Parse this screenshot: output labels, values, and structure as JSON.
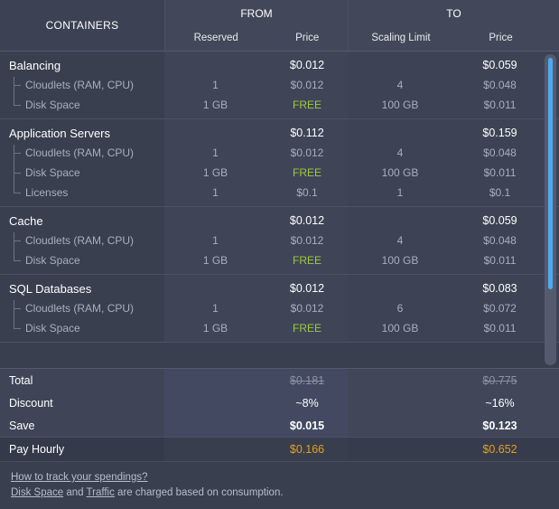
{
  "header": {
    "containers_label": "CONTAINERS",
    "from_label": "FROM",
    "to_label": "TO",
    "from_sub_reserved": "Reserved",
    "from_sub_price": "Price",
    "to_sub_scaling": "Scaling Limit",
    "to_sub_price": "Price"
  },
  "groups": [
    {
      "name": "Balancing",
      "from_price": "$0.012",
      "to_price": "$0.059",
      "items": [
        {
          "name": "Cloudlets (RAM, CPU)",
          "from_qty": "1",
          "from_price": "$0.012",
          "to_qty": "4",
          "to_price": "$0.048",
          "from_free": false
        },
        {
          "name": "Disk Space",
          "from_qty": "1 GB",
          "from_price": "FREE",
          "to_qty": "100 GB",
          "to_price": "$0.011",
          "from_free": true
        }
      ]
    },
    {
      "name": "Application Servers",
      "from_price": "$0.112",
      "to_price": "$0.159",
      "items": [
        {
          "name": "Cloudlets (RAM, CPU)",
          "from_qty": "1",
          "from_price": "$0.012",
          "to_qty": "4",
          "to_price": "$0.048",
          "from_free": false
        },
        {
          "name": "Disk Space",
          "from_qty": "1 GB",
          "from_price": "FREE",
          "to_qty": "100 GB",
          "to_price": "$0.011",
          "from_free": true
        },
        {
          "name": "Licenses",
          "from_qty": "1",
          "from_price": "$0.1",
          "to_qty": "1",
          "to_price": "$0.1",
          "from_free": false
        }
      ]
    },
    {
      "name": "Cache",
      "from_price": "$0.012",
      "to_price": "$0.059",
      "items": [
        {
          "name": "Cloudlets (RAM, CPU)",
          "from_qty": "1",
          "from_price": "$0.012",
          "to_qty": "4",
          "to_price": "$0.048",
          "from_free": false
        },
        {
          "name": "Disk Space",
          "from_qty": "1 GB",
          "from_price": "FREE",
          "to_qty": "100 GB",
          "to_price": "$0.011",
          "from_free": true
        }
      ]
    },
    {
      "name": "SQL Databases",
      "from_price": "$0.012",
      "to_price": "$0.083",
      "items": [
        {
          "name": "Cloudlets (RAM, CPU)",
          "from_qty": "1",
          "from_price": "$0.012",
          "to_qty": "6",
          "to_price": "$0.072",
          "from_free": false
        },
        {
          "name": "Disk Space",
          "from_qty": "1 GB",
          "from_price": "FREE",
          "to_qty": "100 GB",
          "to_price": "$0.011",
          "from_free": true
        }
      ]
    }
  ],
  "summary": [
    {
      "label": "Total",
      "from": "$0.181",
      "to": "$0.775",
      "style": "strike"
    },
    {
      "label": "Discount",
      "from": "~8%",
      "to": "~16%",
      "style": "normal"
    },
    {
      "label": "Save",
      "from": "$0.015",
      "to": "$0.123",
      "style": "bold"
    },
    {
      "label": "Pay Hourly",
      "from": "$0.166",
      "to": "$0.652",
      "style": "orange"
    }
  ],
  "footer": {
    "link_spendings": "How to track your spendings?",
    "link_disk": "Disk Space",
    "and_text": " and ",
    "link_traffic": "Traffic",
    "tail_text": " are charged based on consumption."
  },
  "colors": {
    "free": "#9fc93c",
    "pay_hourly": "#e6a019",
    "scrollbar_thumb": "#4ea8f0",
    "background": "#3a3f4f"
  }
}
